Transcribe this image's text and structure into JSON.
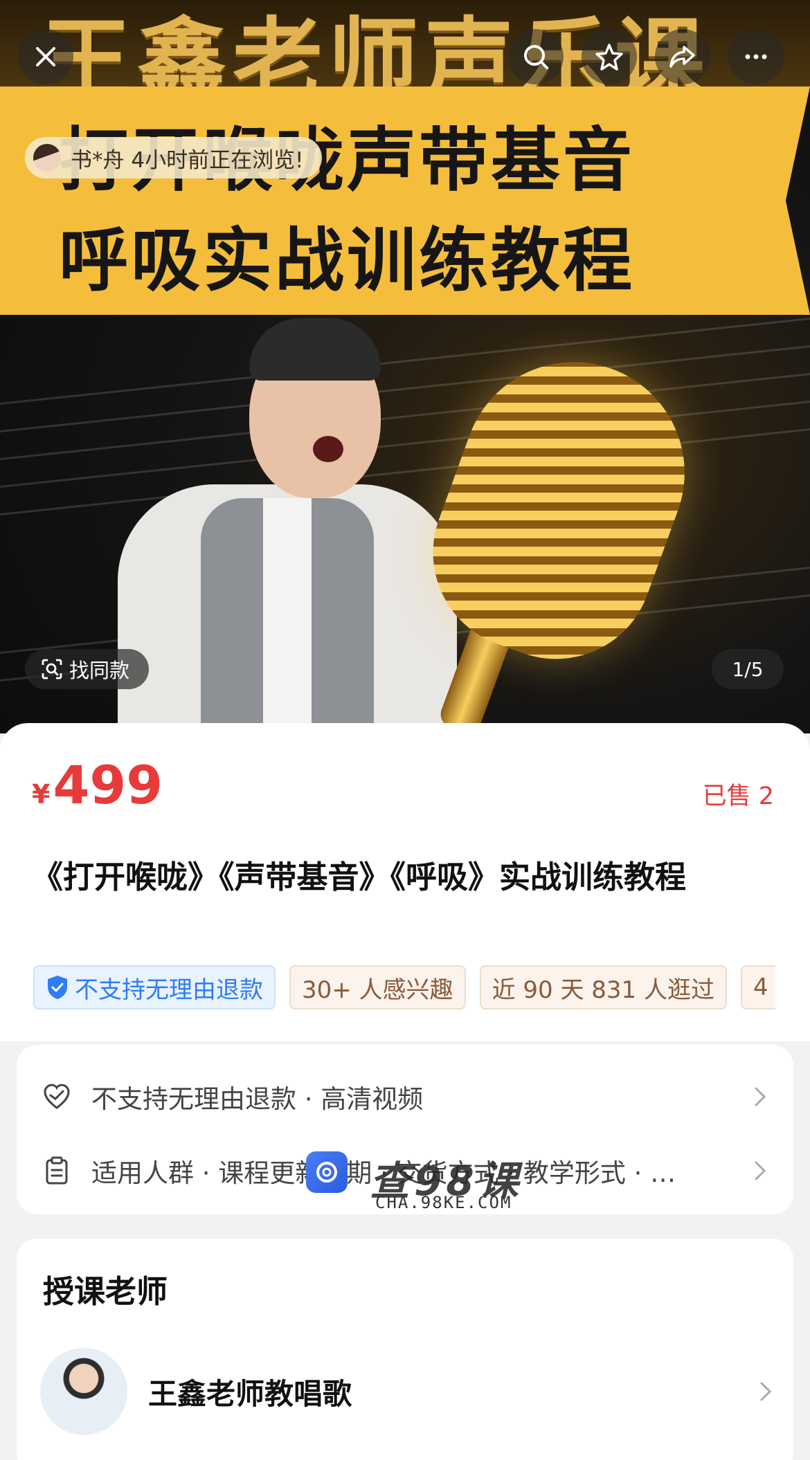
{
  "hero": {
    "banner_top_text": "王鑫老师声乐课",
    "banner_line1": "打开喉咙声带基音",
    "banner_line2": "呼吸实战训练教程",
    "viewer_notice": "书*舟 4小时前正在浏览!",
    "find_similar_label": "找同款",
    "pager": "1/5"
  },
  "toolbar": {
    "close_icon": "close-icon",
    "search_icon": "search-icon",
    "favorite_icon": "star-icon",
    "share_icon": "share-icon",
    "more_icon": "more-icon"
  },
  "product": {
    "currency": "¥",
    "price": "499",
    "sold": "已售 2",
    "title": "《打开喉咙》《声带基音》《呼吸》实战训练教程",
    "tags": [
      {
        "label": "不支持无理由退款",
        "style": "blue"
      },
      {
        "label": "30+ 人感兴趣",
        "style": "brown"
      },
      {
        "label": "近 90 天 831 人逛过",
        "style": "brown"
      },
      {
        "label": "4",
        "style": "brown"
      }
    ]
  },
  "info": {
    "row1": "不支持无理由退款 · 高清视频",
    "row2": "适用人群 · 课程更新周期 · 交货方式 · 教学形式 · …"
  },
  "watermark": {
    "title": "查98课",
    "subtitle": "CHA.98KE.COM"
  },
  "teacher": {
    "heading": "授课老师",
    "name": "王鑫老师教唱歌"
  },
  "colors": {
    "price_red": "#e83a3a",
    "banner_yellow": "#f5bd3c",
    "tag_blue": "#2e7cf6",
    "tag_brown": "#8a5a3c"
  }
}
